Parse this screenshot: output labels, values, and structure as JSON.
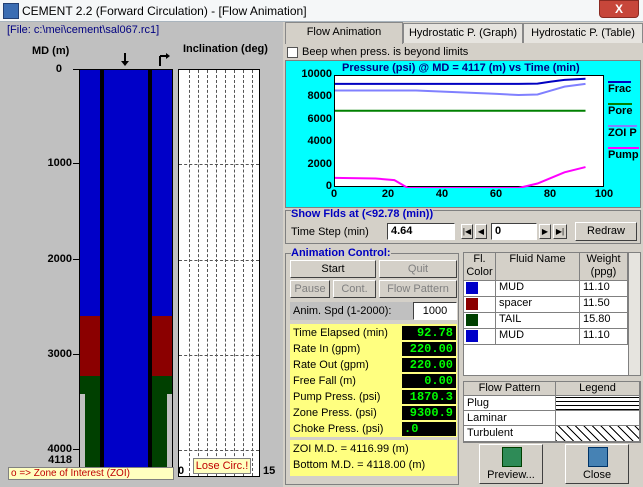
{
  "window": {
    "title": "CEMENT 2.2 (Forward Circulation) - [Flow Animation]",
    "close_label": "X"
  },
  "left": {
    "file": "[File: c:\\mei\\cement\\sal067.rc1]",
    "md_header": "MD (m)",
    "incl_header": "Inclination (deg)",
    "depth_ticks": [
      "0",
      "1000",
      "2000",
      "3000",
      "4000"
    ],
    "bottom_depth": "4118",
    "incl_axis_left": "0",
    "incl_axis_right": "15",
    "zoi_note": "o => Zone of Interest (ZOI)",
    "lose_circ": "Lose Circ.!"
  },
  "tabs": [
    "Flow Animation",
    "Hydrostatic P. (Graph)",
    "Hydrostatic P. (Table)"
  ],
  "beep": {
    "label": "Beep when press. is beyond limits",
    "checked": false
  },
  "chart_data": {
    "type": "line",
    "title": "Pressure (psi) @ MD = 4117 (m) vs Time (min)",
    "xlabel": "",
    "ylabel": "",
    "xlim": [
      0,
      100
    ],
    "ylim": [
      0,
      10000
    ],
    "x_ticks": [
      "0",
      "20",
      "40",
      "60",
      "80",
      "100"
    ],
    "y_ticks": [
      "0",
      "2000",
      "4000",
      "6000",
      "8000",
      "10000"
    ],
    "series": [
      {
        "name": "Frac",
        "color": "#0000c0",
        "x": [
          0,
          60,
          68,
          75,
          80,
          85,
          92.78
        ],
        "y": [
          9300,
          9300,
          9300,
          9320,
          9500,
          9650,
          9750
        ]
      },
      {
        "name": "Pore",
        "color": "#008000",
        "x": [
          0,
          92.78
        ],
        "y": [
          6900,
          6900
        ]
      },
      {
        "name": "ZOI P",
        "color": "#8080ff",
        "x": [
          0,
          30,
          60,
          68,
          75,
          80,
          85,
          92.78
        ],
        "y": [
          8700,
          8700,
          8400,
          8300,
          8350,
          8700,
          9050,
          9300
        ]
      },
      {
        "name": "Pump",
        "color": "#ff00ff",
        "x": [
          0,
          15,
          22,
          27,
          60,
          68,
          75,
          80,
          85,
          92.78
        ],
        "y": [
          900,
          850,
          700,
          0,
          0,
          0,
          400,
          900,
          1400,
          1870
        ]
      }
    ]
  },
  "show_flds": {
    "heading": "Show Flds at (<92.78 (min))",
    "time_step_label": "Time Step (min)",
    "time_step_value": "4.64",
    "step_value": "0",
    "redraw_label": "Redraw"
  },
  "animation": {
    "heading": "Animation Control:",
    "start": "Start",
    "quit": "Quit",
    "pause": "Pause",
    "cont": "Cont.",
    "flow_pattern": "Flow Pattern",
    "speed_label": "Anim. Spd (1-2000):",
    "speed_value": "1000"
  },
  "readouts": [
    {
      "label": "Time Elapsed (min)",
      "value": "92.78"
    },
    {
      "label": "Rate In (gpm)",
      "value": "220.00"
    },
    {
      "label": "Rate Out (gpm)",
      "value": "220.00"
    },
    {
      "label": "Free Fall (m)",
      "value": "0.00"
    },
    {
      "label": "Pump Press. (psi)",
      "value": "1870.3"
    },
    {
      "label": "Zone Press. (psi)",
      "value": "9300.9"
    },
    {
      "label": "Choke Press. (psi)",
      "value": ".0"
    }
  ],
  "zoi_md": "ZOI M.D. = 4116.99 (m)",
  "bottom_md": "Bottom M.D. = 4118.00 (m)",
  "fluids": {
    "headers": [
      "Fl. Color",
      "Fluid Name",
      "Weight (ppg)"
    ],
    "rows": [
      {
        "color": "#0000c8",
        "name": "MUD",
        "weight": "11.10"
      },
      {
        "color": "#8b0000",
        "name": "spacer",
        "weight": "11.50"
      },
      {
        "color": "#004000",
        "name": "TAIL",
        "weight": "15.80"
      },
      {
        "color": "#0000c8",
        "name": "MUD",
        "weight": "11.10"
      }
    ]
  },
  "legend": {
    "headers": [
      "Flow Pattern",
      "Legend"
    ],
    "rows": [
      "Plug",
      "Laminar",
      "Turbulent"
    ]
  },
  "buttons": {
    "preview": "Preview...",
    "close": "Close"
  }
}
